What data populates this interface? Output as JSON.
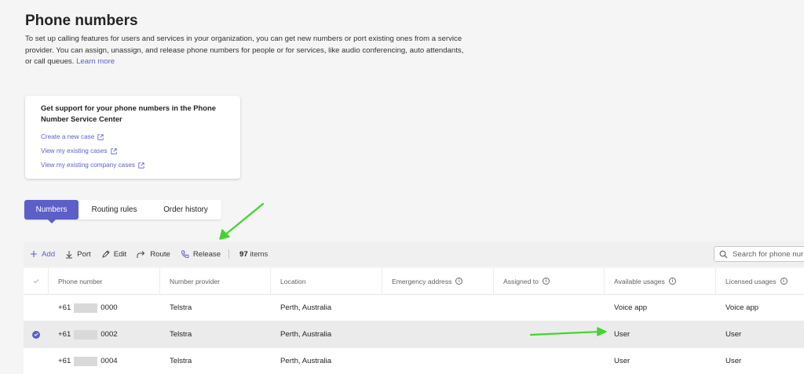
{
  "page": {
    "title": "Phone numbers",
    "description": "To set up calling features for users and services in your organization, you can get new numbers or port existing ones from a service provider. You can assign, unassign, and release phone numbers for people or for services, like audio conferencing, auto attendants, or call queues.",
    "learn_more": "Learn more"
  },
  "support": {
    "title": "Get support for your phone numbers in the Phone Number Service Center",
    "links": [
      "Create a new case",
      "View my existing cases",
      "View my existing company cases"
    ]
  },
  "tabs": [
    "Numbers",
    "Routing rules",
    "Order history"
  ],
  "toolbar": {
    "add": "Add",
    "port": "Port",
    "edit": "Edit",
    "route": "Route",
    "release": "Release",
    "count": "97",
    "count_label": "items",
    "search_placeholder": "Search for phone nur"
  },
  "table": {
    "columns": [
      "Phone number",
      "Number provider",
      "Location",
      "Emergency address",
      "Assigned to",
      "Available usages",
      "Licensed usages"
    ],
    "rows": [
      {
        "prefix": "+61",
        "suffix": "0000",
        "provider": "Telstra",
        "location": "Perth, Australia",
        "emergency": "",
        "assigned": "",
        "available": "Voice app",
        "licensed": "Voice app",
        "selected": false
      },
      {
        "prefix": "+61",
        "suffix": "0002",
        "provider": "Telstra",
        "location": "Perth, Australia",
        "emergency": "",
        "assigned": "",
        "available": "User",
        "licensed": "User",
        "selected": true
      },
      {
        "prefix": "+61",
        "suffix": "0004",
        "provider": "Telstra",
        "location": "Perth, Australia",
        "emergency": "",
        "assigned": "",
        "available": "User",
        "licensed": "User",
        "selected": false
      }
    ]
  },
  "colors": {
    "accent": "#5b5fc7",
    "annotation_arrow": "#3fd62b"
  }
}
